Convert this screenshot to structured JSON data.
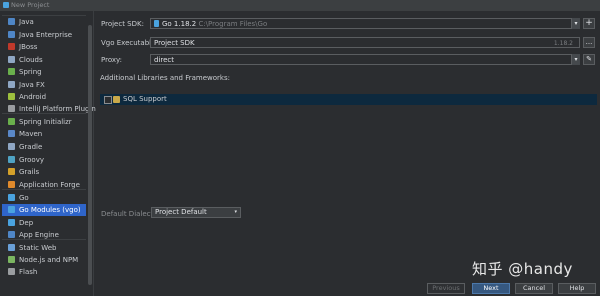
{
  "window": {
    "title": "New Project"
  },
  "sidebar": {
    "items": [
      {
        "label": "Java",
        "color": "#4f86c6"
      },
      {
        "label": "Java Enterprise",
        "color": "#4f86c6"
      },
      {
        "label": "JBoss",
        "color": "#c0392b"
      },
      {
        "label": "Clouds",
        "color": "#8fa7c4"
      },
      {
        "label": "Spring",
        "color": "#6ab04c"
      },
      {
        "label": "Java FX",
        "color": "#8fa7c4"
      },
      {
        "label": "Android",
        "color": "#9dc03e"
      },
      {
        "label": "IntelliJ Platform Plugin",
        "color": "#9a9da0"
      },
      {
        "label": "Spring Initializr",
        "color": "#6ab04c"
      },
      {
        "label": "Maven",
        "color": "#5a88c8"
      },
      {
        "label": "Gradle",
        "color": "#8fa7c4"
      },
      {
        "label": "Groovy",
        "color": "#4fa3c4"
      },
      {
        "label": "Grails",
        "color": "#d4a12a"
      },
      {
        "label": "Application Forge",
        "color": "#e08a2c"
      },
      {
        "label": "Go",
        "color": "#4aa3df"
      },
      {
        "label": "Go Modules (vgo)",
        "color": "#4aa3df",
        "selected": true
      },
      {
        "label": "Dep",
        "color": "#4aa3df"
      },
      {
        "label": "App Engine",
        "color": "#4f86c6"
      },
      {
        "label": "Static Web",
        "color": "#6aa0d8"
      },
      {
        "label": "Node.js and NPM",
        "color": "#7bb661"
      },
      {
        "label": "Flash",
        "color": "#9a9da0"
      }
    ]
  },
  "form": {
    "sdk_label": "Project SDK:",
    "sdk_value": "Go 1.18.2",
    "sdk_path": "C:\\Program Files\\Go",
    "add_button": "+",
    "vgo_label": "Vgo Executable:",
    "vgo_value": "Project SDK",
    "vgo_version": "1.18.2",
    "vgo_more": "...",
    "proxy_label": "Proxy:",
    "proxy_value": "direct",
    "libraries_label": "Additional Libraries and Frameworks:",
    "libraries": [
      {
        "label": "SQL Support",
        "checked": false
      }
    ],
    "dialect_label": "Default Dialect:",
    "dialect_value": "Project Default"
  },
  "footer": {
    "previous": "Previous",
    "next": "Next",
    "cancel": "Cancel",
    "help": "Help"
  },
  "watermark": "知乎 @handy",
  "colors": {
    "selection": "#2f65ca",
    "library_row": "#0d293e",
    "primary_button": "#365880"
  }
}
